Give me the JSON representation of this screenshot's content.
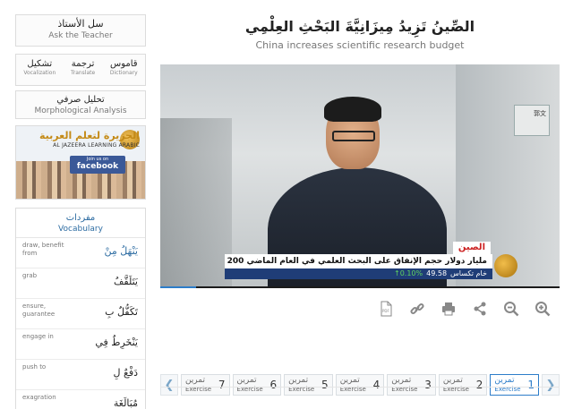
{
  "sidebar": {
    "ask": {
      "ar": "سل الأستاذ",
      "en": "Ask the Teacher"
    },
    "tools": [
      {
        "ar": "قاموس",
        "en": "Dictionary"
      },
      {
        "ar": "ترجمة",
        "en": "Translate"
      },
      {
        "ar": "تشكيل",
        "en": "Vocalization"
      }
    ],
    "morph": {
      "ar": "تحليل صرفي",
      "en": "Morphological Analysis"
    },
    "banner": {
      "logo_ar": "الجزيرة لتعلم العربية",
      "logo_en": "AL JAZEERA LEARNING ARABIC",
      "join": "Join us on",
      "network": "facebook"
    },
    "vocab": {
      "title_ar": "مفردات",
      "title_en": "Vocabulary",
      "items": [
        {
          "def": "draw, benefit from",
          "word": "يَنْهَلُ مِنْ"
        },
        {
          "def": "grab",
          "word": "يَتَلَقَّفُ"
        },
        {
          "def": "ensure, guarantee",
          "word": "تَكَفُّلٌ بِ"
        },
        {
          "def": "engage in",
          "word": "يَنْخَرِطُ فِي"
        },
        {
          "def": "push to",
          "word": "دَفْعٌ لِ"
        },
        {
          "def": "exagration",
          "word": "مُبَالَغَة"
        }
      ]
    }
  },
  "main": {
    "title_ar": "الصِّينُ تَزِيدُ مِيزَانِيَّةَ البَحْثِ العِلْمِي",
    "title_en": "China increases scientific research budget",
    "video": {
      "door_label": "郭文",
      "tag": "الصين",
      "headline": "200 مليار دولار حجم الإنفاق على البحث العلمي في العام الماضي",
      "ticker_label": "خام تكساس",
      "ticker_value": "49.58",
      "ticker_change": "↑0.10%",
      "progress": 0.09
    },
    "toolbar": [
      "pdf",
      "link",
      "print",
      "share",
      "zoom-out",
      "zoom-in"
    ],
    "exercises": [
      {
        "num": "1",
        "ar": "تمرين",
        "en": "Exercise"
      },
      {
        "num": "2",
        "ar": "تمرين",
        "en": "Exercise"
      },
      {
        "num": "3",
        "ar": "تمرين",
        "en": "Exercise"
      },
      {
        "num": "4",
        "ar": "تمرين",
        "en": "Exercise"
      },
      {
        "num": "5",
        "ar": "تمرين",
        "en": "Exercise"
      },
      {
        "num": "6",
        "ar": "تمرين",
        "en": "Exercise"
      },
      {
        "num": "7",
        "ar": "تمرين",
        "en": "Exercise"
      }
    ],
    "active_exercise": 0
  }
}
